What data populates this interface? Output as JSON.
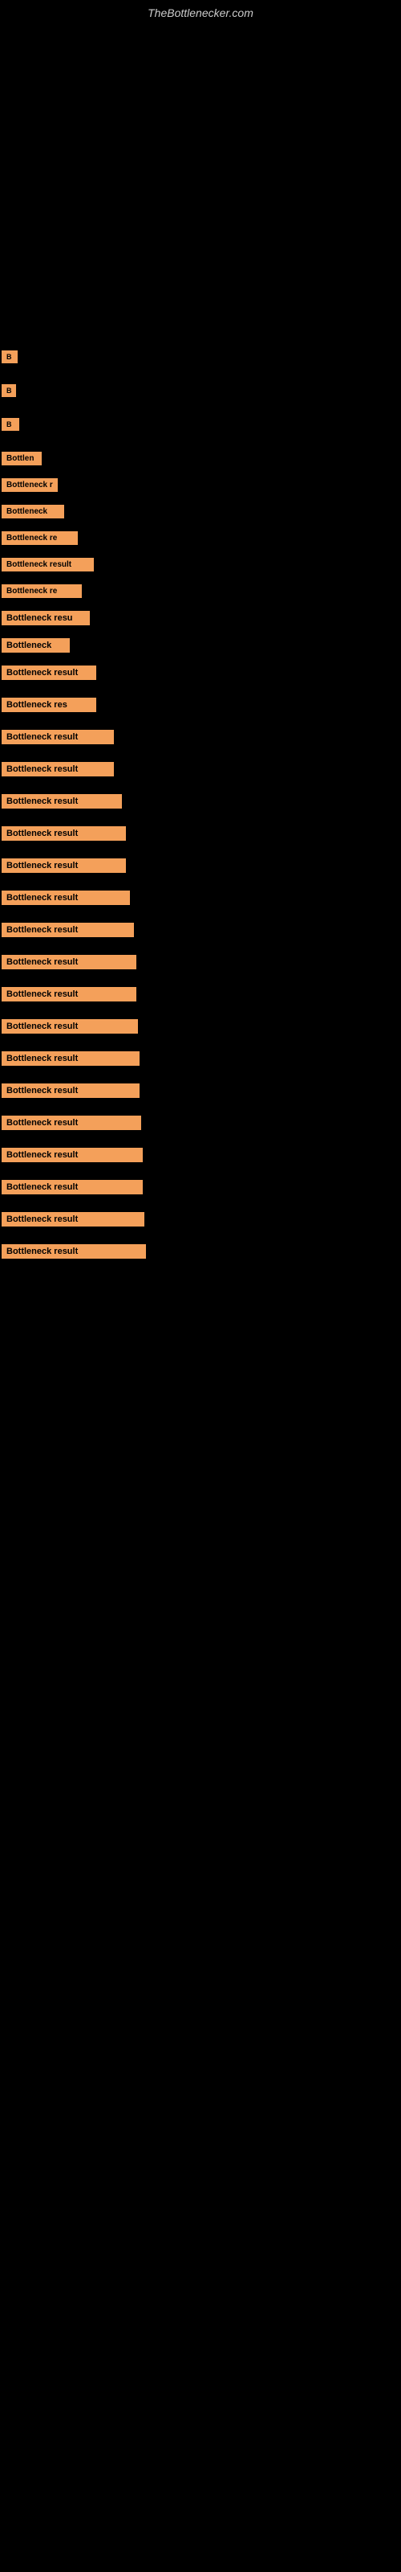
{
  "site": {
    "title": "TheBottlenecker.com"
  },
  "items": [
    {
      "id": 1,
      "label": "B",
      "class": "item-1"
    },
    {
      "id": 2,
      "label": "B",
      "class": "item-2"
    },
    {
      "id": 3,
      "label": "B",
      "class": "item-3"
    },
    {
      "id": 4,
      "label": "Bottlen",
      "class": "item-4"
    },
    {
      "id": 5,
      "label": "Bottleneck r",
      "class": "item-5"
    },
    {
      "id": 6,
      "label": "Bottleneck",
      "class": "item-6"
    },
    {
      "id": 7,
      "label": "Bottleneck re",
      "class": "item-7"
    },
    {
      "id": 8,
      "label": "Bottleneck result",
      "class": "item-8"
    },
    {
      "id": 9,
      "label": "Bottleneck re",
      "class": "item-9"
    },
    {
      "id": 10,
      "label": "Bottleneck resu",
      "class": "item-10"
    },
    {
      "id": 11,
      "label": "Bottleneck",
      "class": "item-11"
    },
    {
      "id": 12,
      "label": "Bottleneck result",
      "class": "item-12"
    },
    {
      "id": 13,
      "label": "Bottleneck res",
      "class": "item-13"
    },
    {
      "id": 14,
      "label": "Bottleneck result",
      "class": "item-14"
    },
    {
      "id": 15,
      "label": "Bottleneck result",
      "class": "item-15"
    },
    {
      "id": 16,
      "label": "Bottleneck result",
      "class": "item-16"
    },
    {
      "id": 17,
      "label": "Bottleneck result",
      "class": "item-17"
    },
    {
      "id": 18,
      "label": "Bottleneck result",
      "class": "item-18"
    },
    {
      "id": 19,
      "label": "Bottleneck result",
      "class": "item-19"
    },
    {
      "id": 20,
      "label": "Bottleneck result",
      "class": "item-20"
    },
    {
      "id": 21,
      "label": "Bottleneck result",
      "class": "item-21"
    },
    {
      "id": 22,
      "label": "Bottleneck result",
      "class": "item-22"
    },
    {
      "id": 23,
      "label": "Bottleneck result",
      "class": "item-23"
    },
    {
      "id": 24,
      "label": "Bottleneck result",
      "class": "item-24"
    },
    {
      "id": 25,
      "label": "Bottleneck result",
      "class": "item-25"
    },
    {
      "id": 26,
      "label": "Bottleneck result",
      "class": "item-26"
    },
    {
      "id": 27,
      "label": "Bottleneck result",
      "class": "item-27"
    },
    {
      "id": 28,
      "label": "Bottleneck result",
      "class": "item-28"
    },
    {
      "id": 29,
      "label": "Bottleneck result",
      "class": "item-29"
    },
    {
      "id": 30,
      "label": "Bottleneck result",
      "class": "item-30"
    }
  ]
}
